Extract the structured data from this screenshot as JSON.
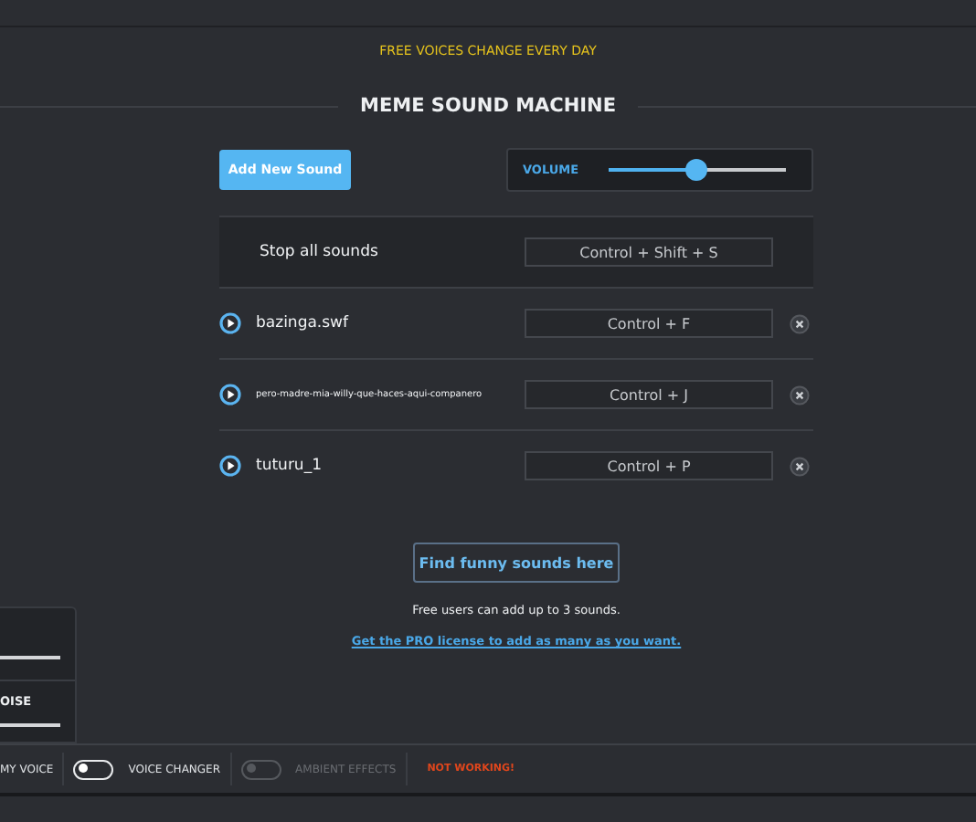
{
  "banner": "FREE VOICES CHANGE EVERY DAY",
  "title": "MEME SOUND MACHINE",
  "add_button": "Add New Sound",
  "volume": {
    "label": "VOLUME",
    "level": 0.5
  },
  "stop_all": {
    "label": "Stop all sounds",
    "hotkey": "Control + Shift + S"
  },
  "sounds": [
    {
      "name": "bazinga.swf",
      "hotkey": "Control + F",
      "small": false
    },
    {
      "name": "pero-madre-mia-willy-que-haces-aqui-companero",
      "hotkey": "Control + J",
      "small": true
    },
    {
      "name": "tuturu_1",
      "hotkey": "Control + P",
      "small": false
    }
  ],
  "find_button": "Find funny sounds here",
  "note": "Free users can add up to 3 sounds.",
  "pro_link": "Get the PRO license to add as many as you want.",
  "side_panel": {
    "label": "OISE"
  },
  "bottom_bar": [
    {
      "kind": "label",
      "text": "MY VOICE"
    },
    {
      "kind": "toggle",
      "text": "VOICE CHANGER",
      "on": false,
      "disabled": false
    },
    {
      "kind": "toggle",
      "text": "AMBIENT EFFECTS",
      "on": false,
      "disabled": true
    },
    {
      "kind": "warning",
      "text": "NOT WORKING!"
    }
  ]
}
